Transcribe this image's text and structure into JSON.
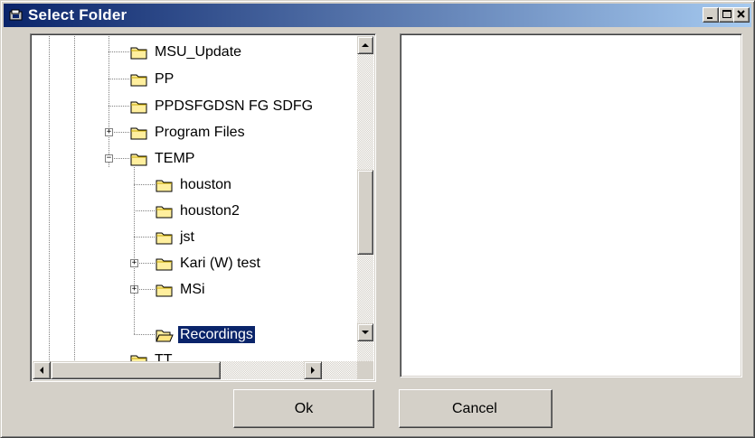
{
  "window": {
    "title": "Select Folder"
  },
  "caption_buttons": {
    "minimize": "minimize-icon",
    "maximize": "maximize-icon",
    "close": "close-icon"
  },
  "tree": {
    "items": [
      {
        "label": "MSU_Update",
        "expander": ""
      },
      {
        "label": "PP",
        "expander": ""
      },
      {
        "label": "PPDSFGDSN FG SDFG",
        "expander": ""
      },
      {
        "label": "Program Files",
        "expander": "+"
      },
      {
        "label": "TEMP",
        "expander": "−"
      },
      {
        "label": "houston",
        "expander": ""
      },
      {
        "label": "houston2",
        "expander": ""
      },
      {
        "label": "jst",
        "expander": ""
      },
      {
        "label": "Kari (W) test",
        "expander": "+"
      },
      {
        "label": "MSi",
        "expander": "+"
      },
      {
        "label": "Recordings",
        "expander": "",
        "selected": true
      },
      {
        "label": "TT",
        "expander": ""
      }
    ]
  },
  "buttons": {
    "ok": "Ok",
    "cancel": "Cancel"
  },
  "colors": {
    "titlebar_start": "#0a246a",
    "titlebar_end": "#a6caf0",
    "selection": "#0a246a",
    "face": "#d4d0c8"
  }
}
